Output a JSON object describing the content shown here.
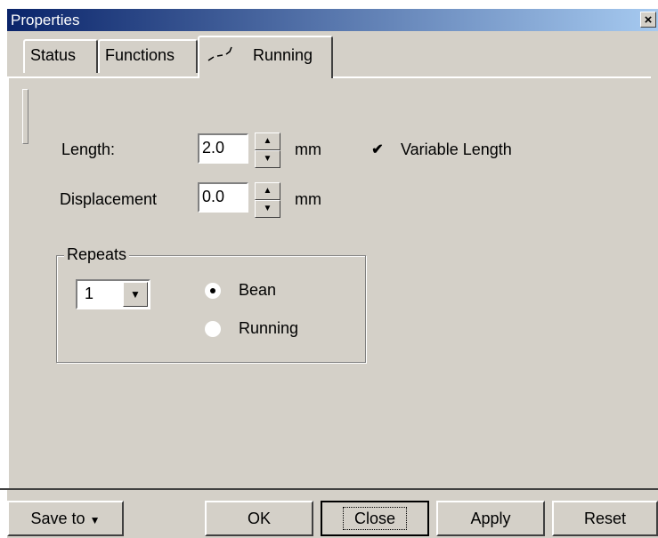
{
  "window": {
    "title": "Properties",
    "close_glyph": "×"
  },
  "tabs": [
    {
      "label": "Status"
    },
    {
      "label": "Functions"
    },
    {
      "label": "Running",
      "icon": "running-stitch-icon",
      "active": true
    }
  ],
  "form": {
    "length": {
      "label": "Length:",
      "value": "2.0",
      "unit": "mm"
    },
    "displacement": {
      "label": "Displacement",
      "value": "0.0",
      "unit": "mm"
    },
    "variable_length": {
      "label": "Variable Length",
      "checked": true,
      "check_glyph": "✔"
    }
  },
  "repeats": {
    "legend": "Repeats",
    "count": "1",
    "options": [
      {
        "label": "Bean",
        "selected": true
      },
      {
        "label": "Running",
        "selected": false
      }
    ]
  },
  "footer": {
    "save_to": "Save to",
    "ok": "OK",
    "close": "Close",
    "apply": "Apply",
    "reset": "Reset"
  },
  "colors": {
    "titlebar_start": "#0a246a",
    "titlebar_end": "#a6caf0",
    "face": "#d4d0c8"
  }
}
